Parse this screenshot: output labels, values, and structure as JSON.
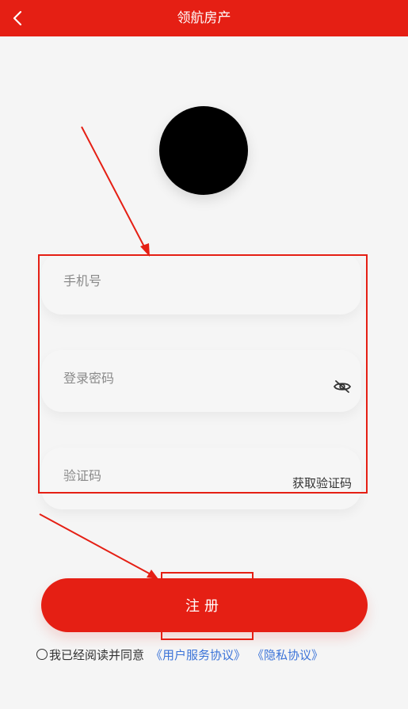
{
  "header": {
    "title": "领航房产",
    "back_icon": "chevron-left-icon"
  },
  "form": {
    "phone_placeholder": "手机号",
    "password_placeholder": "登录密码",
    "code_placeholder": "验证码",
    "get_code_label": "获取验证码",
    "eye_icon": "eye-off-icon"
  },
  "actions": {
    "register_label": "注册"
  },
  "agreement": {
    "prefix": "我已经阅读并同意",
    "user_service": "《用户服务协议》",
    "privacy": "《隐私协议》"
  },
  "colors": {
    "brand": "#e51f14",
    "link": "#3b73d8",
    "background": "#f5f5f5"
  }
}
